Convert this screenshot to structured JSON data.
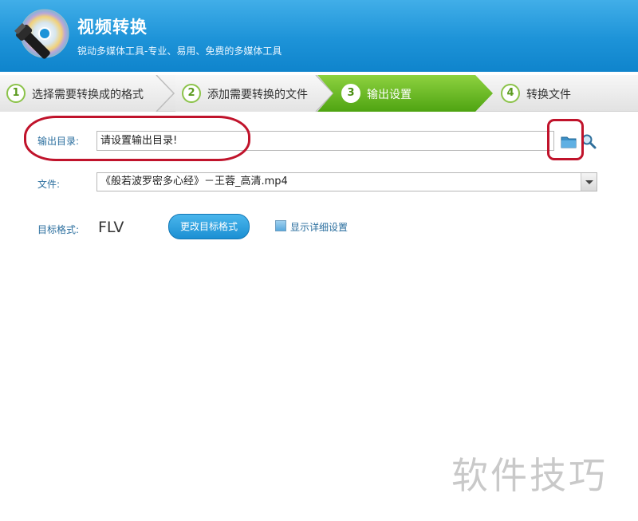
{
  "header": {
    "title": "视频转换",
    "subtitle": "锐动多媒体工具-专业、易用、免费的多媒体工具"
  },
  "steps": [
    {
      "num": "1",
      "label": "选择需要转换成的格式",
      "active": false
    },
    {
      "num": "2",
      "label": "添加需要转换的文件",
      "active": false
    },
    {
      "num": "3",
      "label": "输出设置",
      "active": true
    },
    {
      "num": "4",
      "label": "转换文件",
      "active": false
    }
  ],
  "output": {
    "label": "输出目录:",
    "value": "请设置输出目录!"
  },
  "file": {
    "label": "文件:",
    "selected": "《般若波罗密多心经》－王蓉_高清.mp4"
  },
  "format": {
    "label": "目标格式:",
    "value": "FLV",
    "change_button": "更改目标格式",
    "detail_checkbox": "显示详细设置"
  },
  "watermark": "软件技巧",
  "colors": {
    "header": "#1d93d8",
    "active_step": "#5fb21b",
    "annotation": "#c0132b"
  },
  "icons": [
    "disc-logo-icon",
    "folder-icon",
    "search-icon",
    "dropdown-arrow-icon"
  ]
}
